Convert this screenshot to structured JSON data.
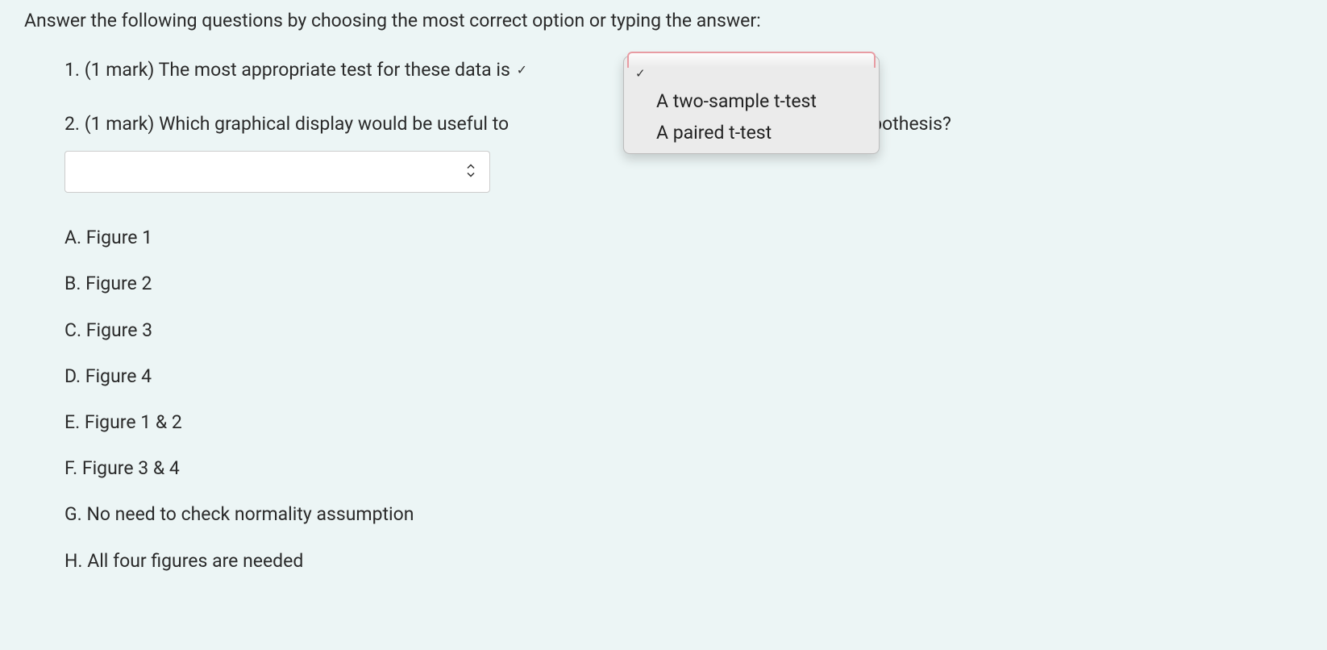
{
  "intro": "Answer the following questions by choosing the most correct option or typing the answer:",
  "q1": {
    "number": "1.",
    "marks": "(1 mark)",
    "text": "The most appropriate test for these data is"
  },
  "q2": {
    "number": "2.",
    "marks": "(1 mark)",
    "text_before": "Which graphical display would be useful to",
    "text_after": "ion for this hypothesis?"
  },
  "options": [
    {
      "letter": "A.",
      "text": "Figure 1"
    },
    {
      "letter": "B.",
      "text": "Figure 2"
    },
    {
      "letter": "C.",
      "text": "Figure 3"
    },
    {
      "letter": "D.",
      "text": "Figure 4"
    },
    {
      "letter": "E.",
      "text": "Figure 1 & 2"
    },
    {
      "letter": "F.",
      "text": "Figure 3 & 4"
    },
    {
      "letter": "G.",
      "text": "No need to check normality assumption"
    },
    {
      "letter": "H.",
      "text": "All four figures are needed"
    }
  ],
  "dropdown": {
    "items": [
      {
        "label": "",
        "selected": true
      },
      {
        "label": "A two-sample t-test",
        "selected": false
      },
      {
        "label": "A paired t-test",
        "selected": false
      }
    ]
  }
}
